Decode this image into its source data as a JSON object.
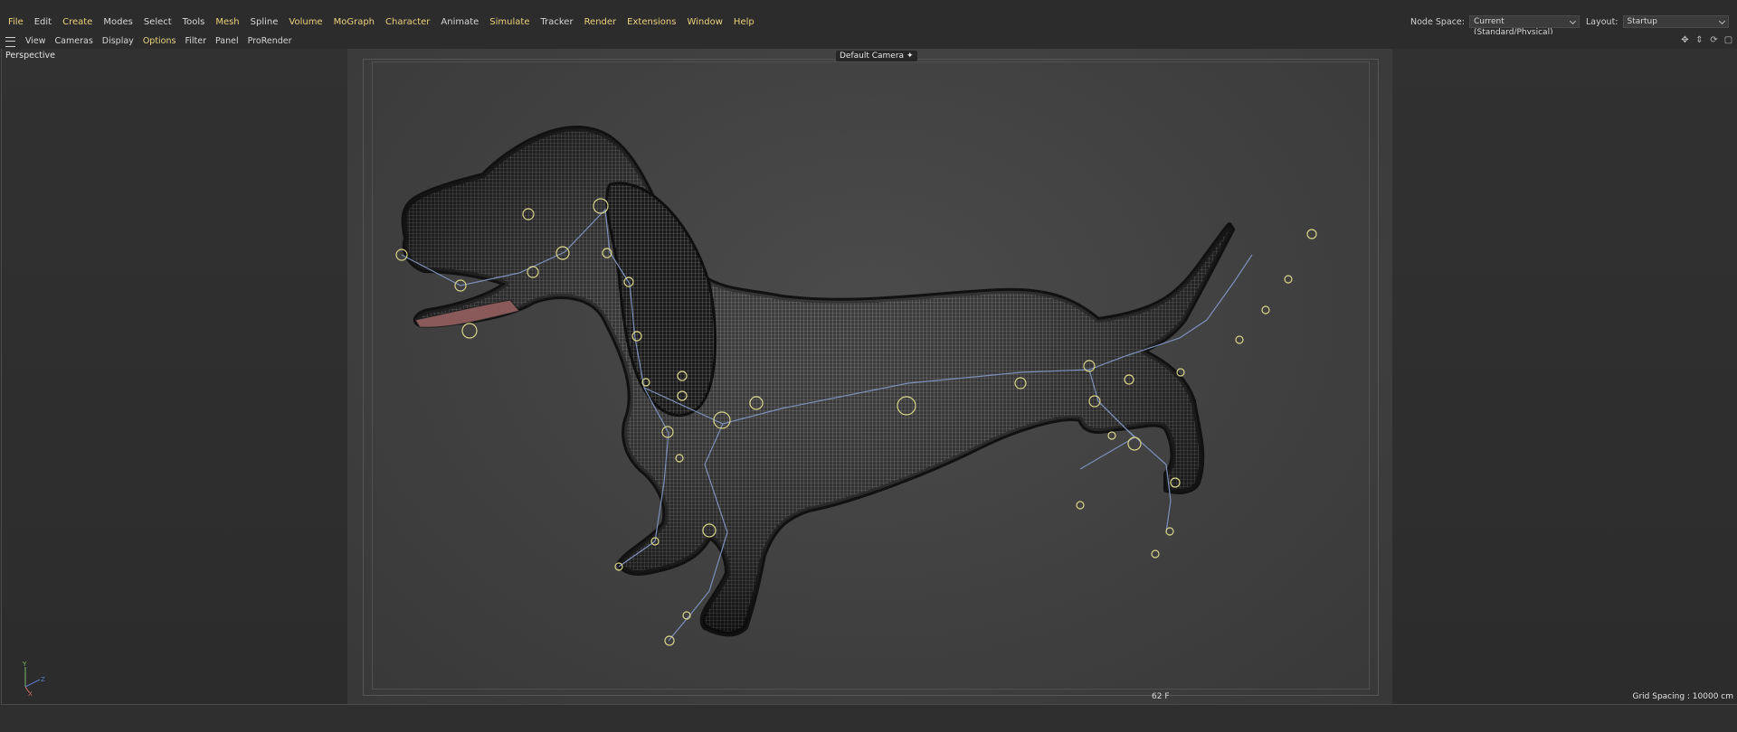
{
  "menu": {
    "items": [
      {
        "label": "File",
        "accent": true
      },
      {
        "label": "Edit",
        "accent": false
      },
      {
        "label": "Create",
        "accent": true
      },
      {
        "label": "Modes",
        "accent": false
      },
      {
        "label": "Select",
        "accent": false
      },
      {
        "label": "Tools",
        "accent": false
      },
      {
        "label": "Mesh",
        "accent": true
      },
      {
        "label": "Spline",
        "accent": false
      },
      {
        "label": "Volume",
        "accent": true
      },
      {
        "label": "MoGraph",
        "accent": true
      },
      {
        "label": "Character",
        "accent": true
      },
      {
        "label": "Animate",
        "accent": false
      },
      {
        "label": "Simulate",
        "accent": true
      },
      {
        "label": "Tracker",
        "accent": false
      },
      {
        "label": "Render",
        "accent": true
      },
      {
        "label": "Extensions",
        "accent": true
      },
      {
        "label": "Window",
        "accent": true
      },
      {
        "label": "Help",
        "accent": true
      }
    ],
    "node_space_label": "Node Space:",
    "node_space_value": "Current (Standard/Physical)",
    "layout_label": "Layout:",
    "layout_value": "Startup"
  },
  "viewport_menu": {
    "items": [
      {
        "label": "View",
        "accent": false
      },
      {
        "label": "Cameras",
        "accent": false
      },
      {
        "label": "Display",
        "accent": false
      },
      {
        "label": "Options",
        "accent": true
      },
      {
        "label": "Filter",
        "accent": false
      },
      {
        "label": "Panel",
        "accent": false
      },
      {
        "label": "ProRender",
        "accent": false
      }
    ],
    "nav_icons": [
      "move-view-icon",
      "pan-view-icon",
      "rotate-view-icon",
      "maximize-view-icon"
    ]
  },
  "viewport": {
    "projection": "Perspective",
    "camera": "Default Camera",
    "frame": "62 F",
    "grid_spacing": "Grid Spacing : 10000 cm",
    "axis_labels": {
      "x": "X",
      "y": "Y",
      "z": "Z"
    }
  },
  "colors": {
    "accent_text": "#e8d27a",
    "background": "#2f2f2f",
    "joint": "#d8d48a",
    "bone": "#7d8fb8"
  }
}
